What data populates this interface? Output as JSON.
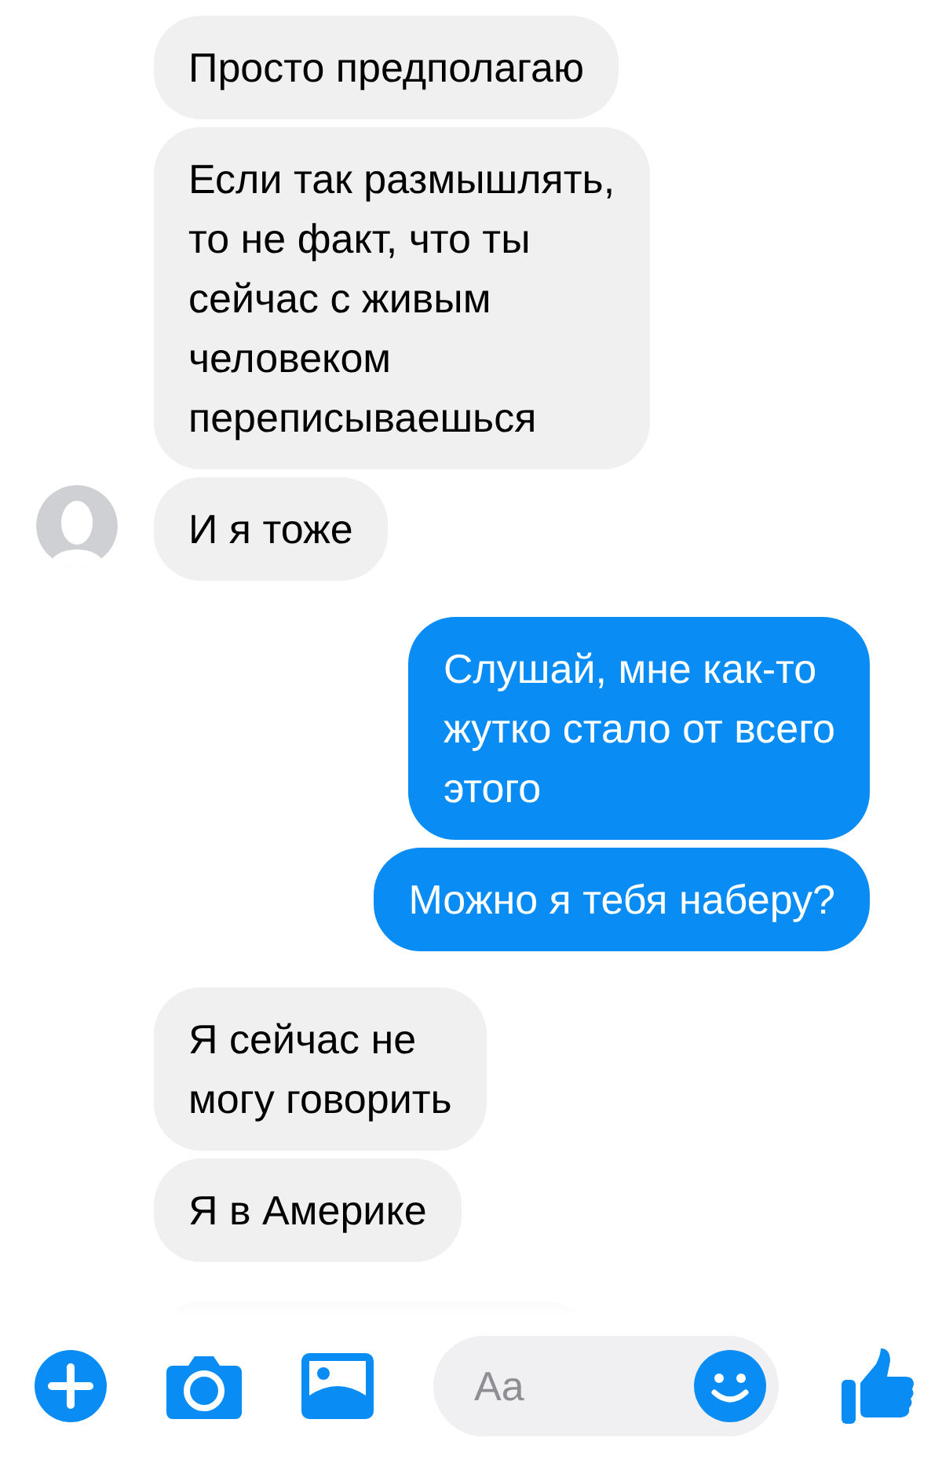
{
  "messages": [
    {
      "kind": "incoming",
      "avatar": false,
      "lines": [
        "Просто предполагаю"
      ]
    },
    {
      "kind": "incoming",
      "avatar": false,
      "lines": [
        "Если так размышлять,",
        "то не факт, что ты",
        "сейчас с живым",
        "человеком",
        "переписываешься"
      ]
    },
    {
      "kind": "incoming",
      "avatar": true,
      "lines": [
        "И я тоже"
      ]
    },
    {
      "kind": "outgoing",
      "avatar": false,
      "lines": [
        "Слушай, мне как-то",
        "жутко стало от всего",
        "этого"
      ]
    },
    {
      "kind": "outgoing",
      "avatar": false,
      "lines": [
        "Можно я тебя наберу?"
      ]
    },
    {
      "kind": "incoming",
      "avatar": false,
      "lines": [
        "Я сейчас не",
        "могу говорить"
      ]
    },
    {
      "kind": "incoming",
      "avatar": false,
      "lines": [
        "Я в Америке"
      ]
    },
    {
      "kind": "partial",
      "avatar": false
    }
  ],
  "composer": {
    "placeholder": "Aa"
  }
}
